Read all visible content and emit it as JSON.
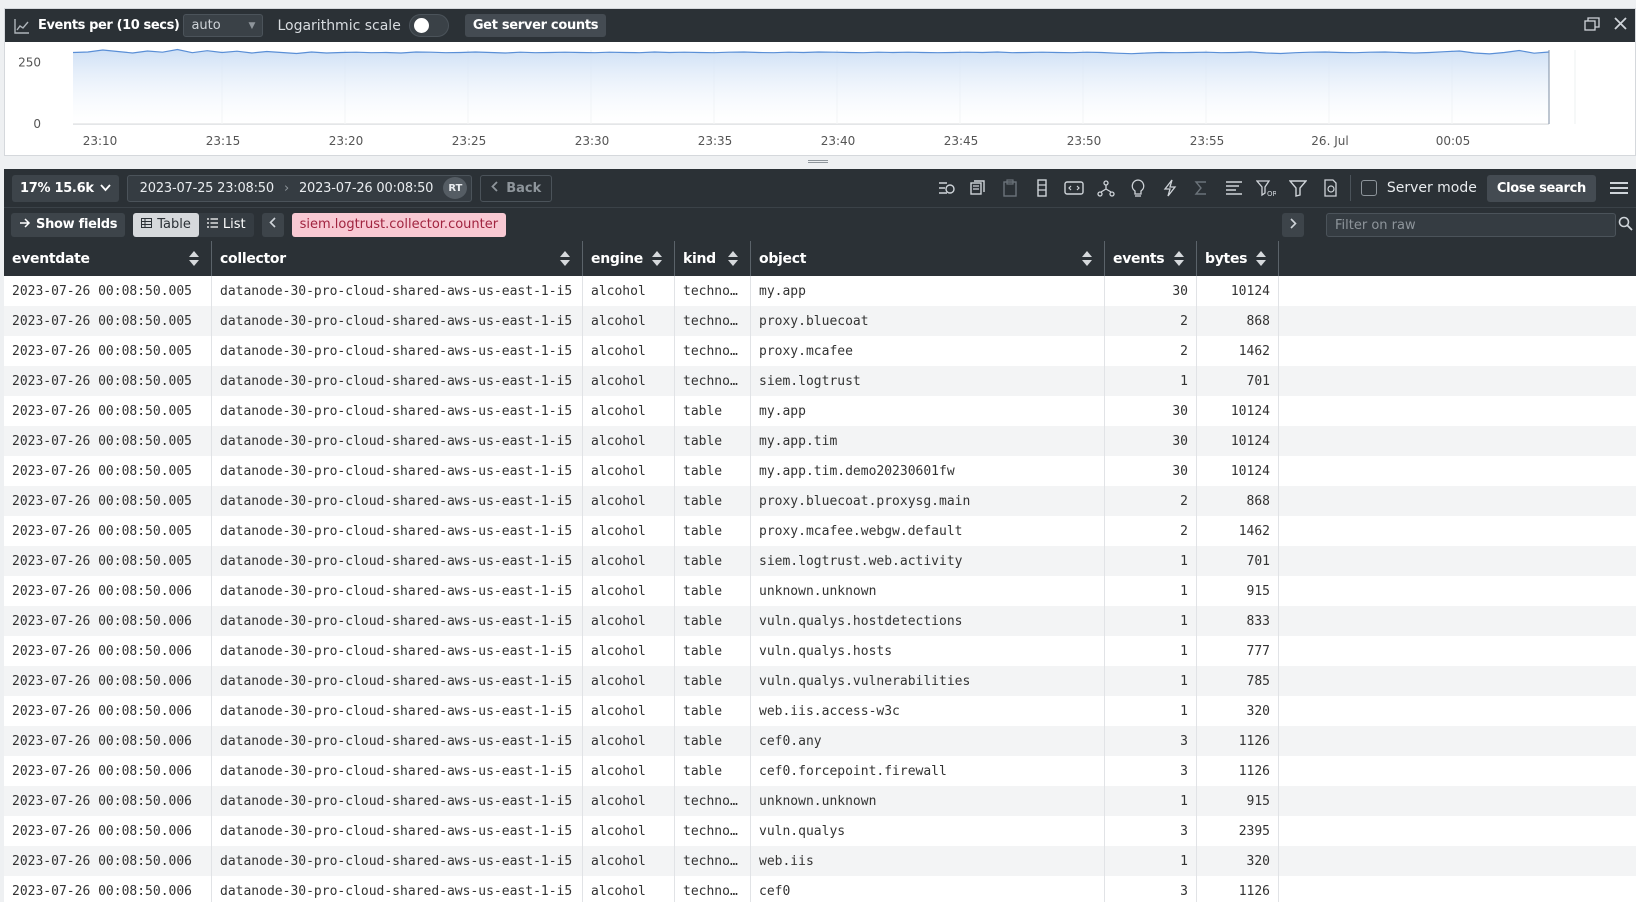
{
  "chart_toolbar": {
    "icon": "chart-icon",
    "title": "Events per (10 secs)",
    "interval_select": "auto",
    "log_scale_label": "Logarithmic scale",
    "log_scale_on": false,
    "server_counts_button": "Get server counts"
  },
  "chart_data": {
    "type": "area",
    "title": "",
    "y_ticks": [
      "250",
      "0"
    ],
    "ylim": [
      0,
      300
    ],
    "x_ticks": [
      "23:10",
      "23:15",
      "23:20",
      "23:25",
      "23:30",
      "23:35",
      "23:40",
      "23:45",
      "23:50",
      "23:55",
      "26. Jul",
      "00:05"
    ],
    "x_range": [
      "23:08:50",
      "00:08:50"
    ],
    "series": [
      {
        "values": [
          290,
          292,
          300,
          294,
          288,
          296,
          291,
          302,
          289,
          297,
          290,
          295,
          288,
          294,
          290,
          286,
          292,
          288,
          290,
          291,
          289,
          290,
          288,
          292,
          291,
          289,
          290,
          292,
          290,
          288,
          291,
          289,
          290,
          291,
          290,
          289,
          291,
          290,
          289,
          292,
          290,
          291,
          290,
          289,
          291,
          292,
          290,
          289,
          291,
          290,
          292,
          291,
          290,
          289,
          291,
          290,
          291,
          290,
          289,
          290,
          291,
          290,
          292,
          289,
          290,
          291,
          290,
          289,
          291,
          290,
          287,
          285,
          288,
          290,
          289,
          290,
          291,
          289,
          290,
          292,
          288,
          286,
          289,
          291,
          292,
          290,
          289,
          291,
          292,
          290,
          288,
          290,
          293,
          296,
          288,
          284,
          290,
          298,
          287,
          292
        ]
      }
    ],
    "fill_color": "#cfe0f5",
    "line_color": "#5a8fd6",
    "grid": true
  },
  "search_bar": {
    "percent_button": "17% 15.6k",
    "date_from": "2023-07-25 23:08:50",
    "date_to": "2023-07-26 00:08:50",
    "rt_badge": "RT",
    "back_button": "Back",
    "server_mode_label": "Server mode",
    "close_search_button": "Close search"
  },
  "query_bar": {
    "show_fields_button": "Show fields",
    "table_tab": "Table",
    "list_tab": "List",
    "query_tag": "siem.logtrust.collector.counter",
    "filter_placeholder": "Filter on raw"
  },
  "table": {
    "columns": [
      "eventdate",
      "collector",
      "engine",
      "kind",
      "object",
      "events",
      "bytes"
    ],
    "rows": [
      [
        "2023-07-26 00:08:50.005",
        "datanode-30-pro-cloud-shared-aws-us-east-1-i5",
        "alcohol",
        "techno…",
        "my.app",
        "30",
        "10124"
      ],
      [
        "2023-07-26 00:08:50.005",
        "datanode-30-pro-cloud-shared-aws-us-east-1-i5",
        "alcohol",
        "techno…",
        "proxy.bluecoat",
        "2",
        "868"
      ],
      [
        "2023-07-26 00:08:50.005",
        "datanode-30-pro-cloud-shared-aws-us-east-1-i5",
        "alcohol",
        "techno…",
        "proxy.mcafee",
        "2",
        "1462"
      ],
      [
        "2023-07-26 00:08:50.005",
        "datanode-30-pro-cloud-shared-aws-us-east-1-i5",
        "alcohol",
        "techno…",
        "siem.logtrust",
        "1",
        "701"
      ],
      [
        "2023-07-26 00:08:50.005",
        "datanode-30-pro-cloud-shared-aws-us-east-1-i5",
        "alcohol",
        "table",
        "my.app",
        "30",
        "10124"
      ],
      [
        "2023-07-26 00:08:50.005",
        "datanode-30-pro-cloud-shared-aws-us-east-1-i5",
        "alcohol",
        "table",
        "my.app.tim",
        "30",
        "10124"
      ],
      [
        "2023-07-26 00:08:50.005",
        "datanode-30-pro-cloud-shared-aws-us-east-1-i5",
        "alcohol",
        "table",
        "my.app.tim.demo20230601fw",
        "30",
        "10124"
      ],
      [
        "2023-07-26 00:08:50.005",
        "datanode-30-pro-cloud-shared-aws-us-east-1-i5",
        "alcohol",
        "table",
        "proxy.bluecoat.proxysg.main",
        "2",
        "868"
      ],
      [
        "2023-07-26 00:08:50.005",
        "datanode-30-pro-cloud-shared-aws-us-east-1-i5",
        "alcohol",
        "table",
        "proxy.mcafee.webgw.default",
        "2",
        "1462"
      ],
      [
        "2023-07-26 00:08:50.005",
        "datanode-30-pro-cloud-shared-aws-us-east-1-i5",
        "alcohol",
        "table",
        "siem.logtrust.web.activity",
        "1",
        "701"
      ],
      [
        "2023-07-26 00:08:50.006",
        "datanode-30-pro-cloud-shared-aws-us-east-1-i5",
        "alcohol",
        "table",
        "unknown.unknown",
        "1",
        "915"
      ],
      [
        "2023-07-26 00:08:50.006",
        "datanode-30-pro-cloud-shared-aws-us-east-1-i5",
        "alcohol",
        "table",
        "vuln.qualys.hostdetections",
        "1",
        "833"
      ],
      [
        "2023-07-26 00:08:50.006",
        "datanode-30-pro-cloud-shared-aws-us-east-1-i5",
        "alcohol",
        "table",
        "vuln.qualys.hosts",
        "1",
        "777"
      ],
      [
        "2023-07-26 00:08:50.006",
        "datanode-30-pro-cloud-shared-aws-us-east-1-i5",
        "alcohol",
        "table",
        "vuln.qualys.vulnerabilities",
        "1",
        "785"
      ],
      [
        "2023-07-26 00:08:50.006",
        "datanode-30-pro-cloud-shared-aws-us-east-1-i5",
        "alcohol",
        "table",
        "web.iis.access-w3c",
        "1",
        "320"
      ],
      [
        "2023-07-26 00:08:50.006",
        "datanode-30-pro-cloud-shared-aws-us-east-1-i5",
        "alcohol",
        "table",
        "cef0.any",
        "3",
        "1126"
      ],
      [
        "2023-07-26 00:08:50.006",
        "datanode-30-pro-cloud-shared-aws-us-east-1-i5",
        "alcohol",
        "table",
        "cef0.forcepoint.firewall",
        "3",
        "1126"
      ],
      [
        "2023-07-26 00:08:50.006",
        "datanode-30-pro-cloud-shared-aws-us-east-1-i5",
        "alcohol",
        "techno…",
        "unknown.unknown",
        "1",
        "915"
      ],
      [
        "2023-07-26 00:08:50.006",
        "datanode-30-pro-cloud-shared-aws-us-east-1-i5",
        "alcohol",
        "techno…",
        "vuln.qualys",
        "3",
        "2395"
      ],
      [
        "2023-07-26 00:08:50.006",
        "datanode-30-pro-cloud-shared-aws-us-east-1-i5",
        "alcohol",
        "techno…",
        "web.iis",
        "1",
        "320"
      ],
      [
        "2023-07-26 00:08:50.006",
        "datanode-30-pro-cloud-shared-aws-us-east-1-i5",
        "alcohol",
        "techno…",
        "cef0",
        "3",
        "1126"
      ]
    ]
  }
}
